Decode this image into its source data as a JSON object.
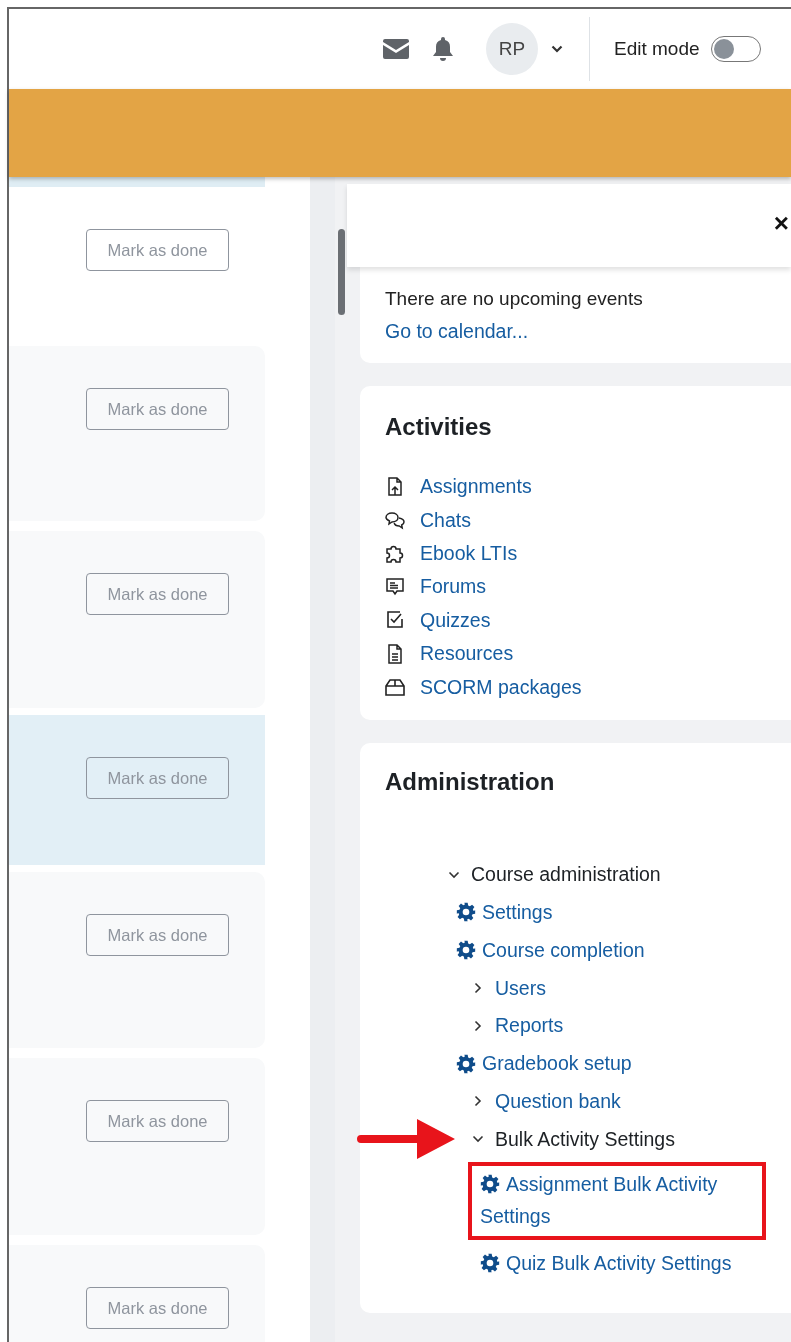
{
  "header": {
    "avatar_initials": "RP",
    "edit_mode": {
      "label": "Edit mode",
      "on": false
    }
  },
  "course_sections": [
    {
      "kind": "plain",
      "button": "Mark as done"
    },
    {
      "kind": "shaded",
      "button": "Mark as done"
    },
    {
      "kind": "shaded",
      "button": "Mark as done"
    },
    {
      "kind": "highlighted",
      "button": "Mark as done"
    },
    {
      "kind": "shaded",
      "button": "Mark as done"
    },
    {
      "kind": "shaded",
      "button": "Mark as done"
    },
    {
      "kind": "shaded",
      "button": "Mark as done"
    }
  ],
  "drawer": {
    "close": "×",
    "upcoming": {
      "message": "There are no upcoming events",
      "link": "Go to calendar..."
    },
    "activities": {
      "title": "Activities",
      "items": [
        {
          "kind": "assignment",
          "label": "Assignments"
        },
        {
          "kind": "chat",
          "label": "Chats"
        },
        {
          "kind": "lti",
          "label": "Ebook LTIs"
        },
        {
          "kind": "forum",
          "label": "Forums"
        },
        {
          "kind": "quiz",
          "label": "Quizzes"
        },
        {
          "kind": "resource",
          "label": "Resources"
        },
        {
          "kind": "scorm",
          "label": "SCORM packages"
        }
      ]
    },
    "administration": {
      "title": "Administration",
      "tree": [
        {
          "kind": "branch",
          "label": "Course administration",
          "link": false,
          "expanded": true,
          "boxed": false,
          "pointed": false,
          "children": [
            {
              "kind": "leaf",
              "label": "Settings",
              "boxed": false,
              "pointed": false
            },
            {
              "kind": "leaf",
              "label": "Course completion",
              "boxed": false,
              "pointed": false
            },
            {
              "kind": "branch",
              "label": "Users",
              "link": true,
              "expanded": false,
              "boxed": false,
              "pointed": false
            },
            {
              "kind": "branch",
              "label": "Reports",
              "link": true,
              "expanded": false,
              "boxed": false,
              "pointed": false
            },
            {
              "kind": "leaf",
              "label": "Gradebook setup",
              "boxed": false,
              "pointed": false
            },
            {
              "kind": "branch",
              "label": "Question bank",
              "link": true,
              "expanded": false,
              "boxed": false,
              "pointed": false
            },
            {
              "kind": "branch",
              "label": "Bulk Activity Settings",
              "link": false,
              "expanded": true,
              "boxed": false,
              "pointed": true,
              "children": [
                {
                  "kind": "leaf",
                  "label": "Assignment Bulk Activity Settings",
                  "boxed": true,
                  "pointed": false
                },
                {
                  "kind": "leaf",
                  "label": "Quiz Bulk Activity Settings",
                  "boxed": false,
                  "pointed": false
                }
              ]
            }
          ]
        }
      ]
    }
  }
}
